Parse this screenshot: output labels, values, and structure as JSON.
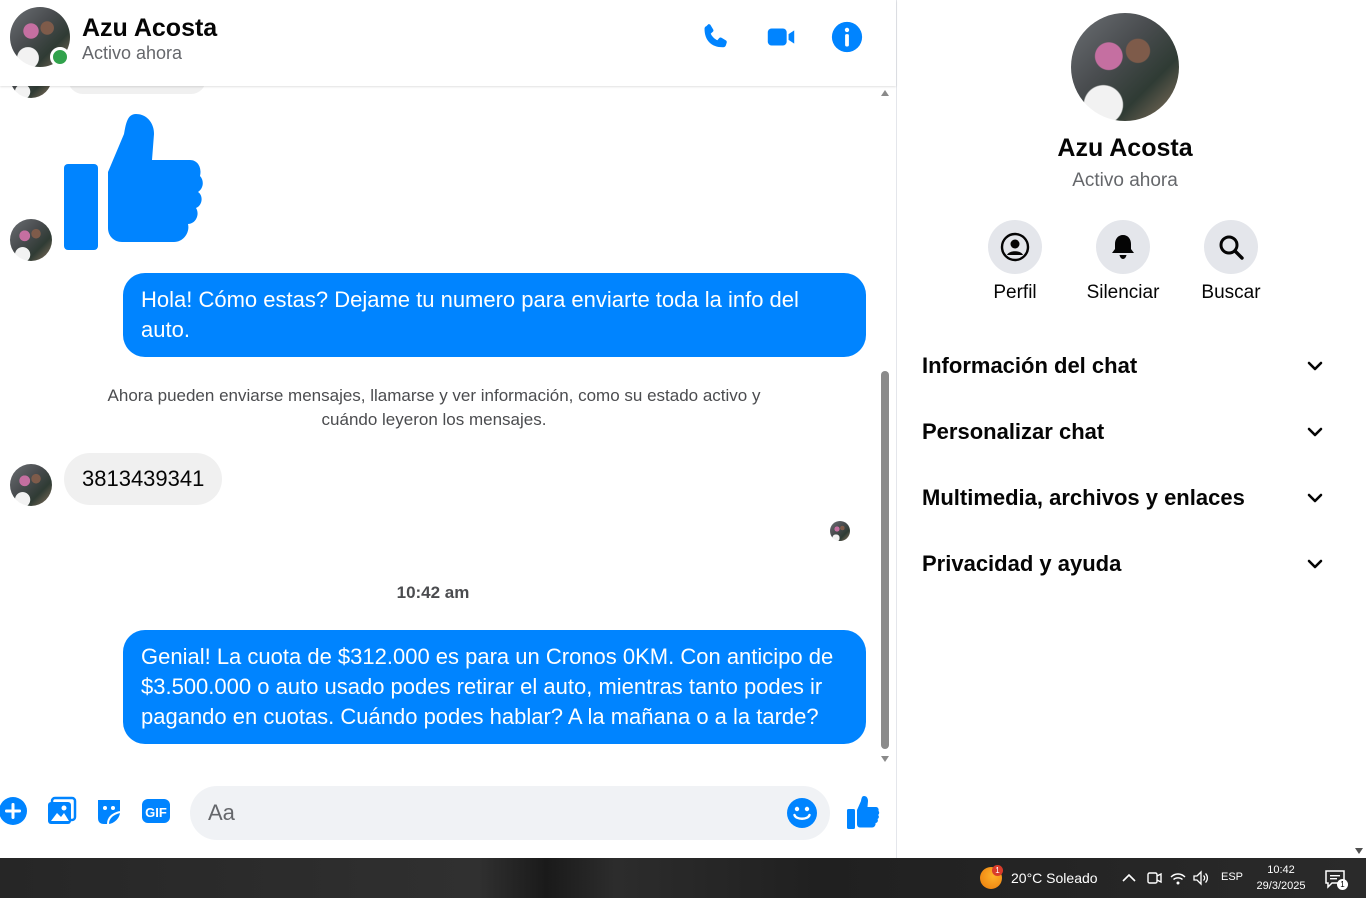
{
  "header": {
    "name": "Azu Acosta",
    "status": "Activo ahora"
  },
  "messages": {
    "outgoing_1": "Hola! Cómo estas? Dejame tu numero para enviarte toda la info del auto.",
    "notice": "Ahora pueden enviarse mensajes, llamarse y ver información, como su estado activo y cuándo leyeron los mensajes.",
    "incoming_1": "3813439341",
    "timestamp": "10:42 am",
    "outgoing_2": "Genial! La cuota de $312.000 es para un Cronos 0KM. Con anticipo de $3.500.000 o auto usado podes retirar el auto, mientras tanto podes ir pagando en cuotas. Cuándo podes hablar? A la mañana o a la tarde?"
  },
  "composer": {
    "placeholder": "Aa",
    "icons": [
      "plus-icon",
      "image-icon",
      "sticker-icon",
      "gif-icon",
      "emoji-icon",
      "thumbs-up-icon"
    ]
  },
  "info_panel": {
    "name": "Azu Acosta",
    "status": "Activo ahora",
    "actions": [
      {
        "label": "Perfil",
        "icon": "profile-icon"
      },
      {
        "label": "Silenciar",
        "icon": "bell-icon"
      },
      {
        "label": "Buscar",
        "icon": "search-icon"
      }
    ],
    "sections": [
      "Información del chat",
      "Personalizar chat",
      "Multimedia, archivos y enlaces",
      "Privacidad y ayuda"
    ]
  },
  "taskbar": {
    "weather": "20°C  Soleado",
    "weather_badge": "1",
    "language": "ESP",
    "time": "10:42",
    "date": "29/3/2025",
    "notification_count": "1"
  },
  "colors": {
    "accent": "#0084ff",
    "incoming_bubble": "#f0f0f0",
    "online": "#31a24c"
  }
}
